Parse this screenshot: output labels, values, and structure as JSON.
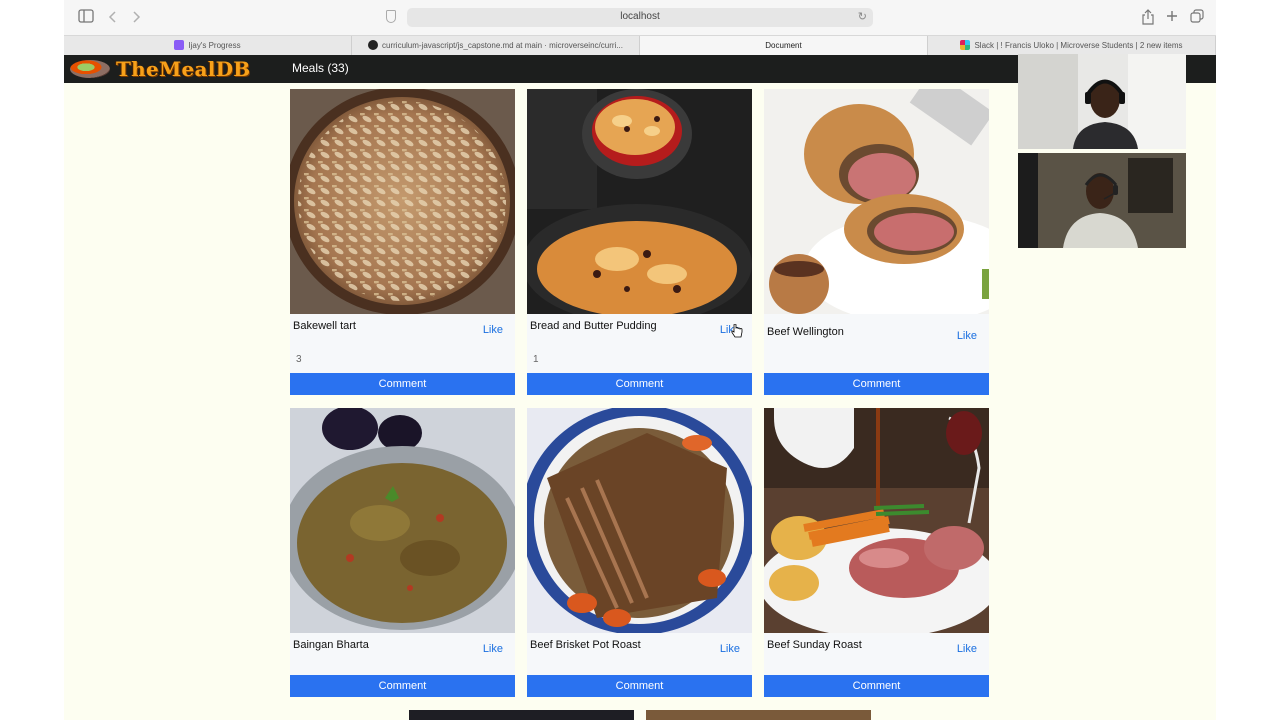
{
  "browser": {
    "url": "localhost",
    "tabs": [
      {
        "label": "Ijay's Progress",
        "active": false,
        "favicon_color": "#8a5cf6"
      },
      {
        "label": "curriculum-javascript/js_capstone.md at main · microverseinc/curri...",
        "active": false,
        "favicon_color": "#222222"
      },
      {
        "label": "Document",
        "active": true,
        "favicon_color": ""
      },
      {
        "label": "Slack | ! Francis Uloko | Microverse Students | 2 new items",
        "active": false,
        "favicon_color": "#e01e5a"
      }
    ]
  },
  "site": {
    "logo_text": "TheMealDB",
    "nav_meals": "Meals (33)"
  },
  "meals": [
    {
      "name": "Bakewell tart",
      "like_label": "Like",
      "likes": "3",
      "comment_label": "Comment"
    },
    {
      "name": "Bread and Butter Pudding",
      "like_label": "Like",
      "likes": "1",
      "comment_label": "Comment"
    },
    {
      "name": "Beef Wellington",
      "like_label": "Like",
      "likes": "",
      "comment_label": "Comment"
    },
    {
      "name": "Baingan Bharta",
      "like_label": "Like",
      "likes": "",
      "comment_label": "Comment"
    },
    {
      "name": "Beef Brisket Pot Roast",
      "like_label": "Like",
      "likes": "",
      "comment_label": "Comment"
    },
    {
      "name": "Beef Sunday Roast",
      "like_label": "Like",
      "likes": "",
      "comment_label": "Comment"
    }
  ],
  "colors": {
    "page_bg": "#fdfef1",
    "header_bg": "#1c1e1d",
    "logo_orange": "#f7a11a",
    "comment_button": "#2a72f0",
    "like_link": "#1a6fe0"
  }
}
